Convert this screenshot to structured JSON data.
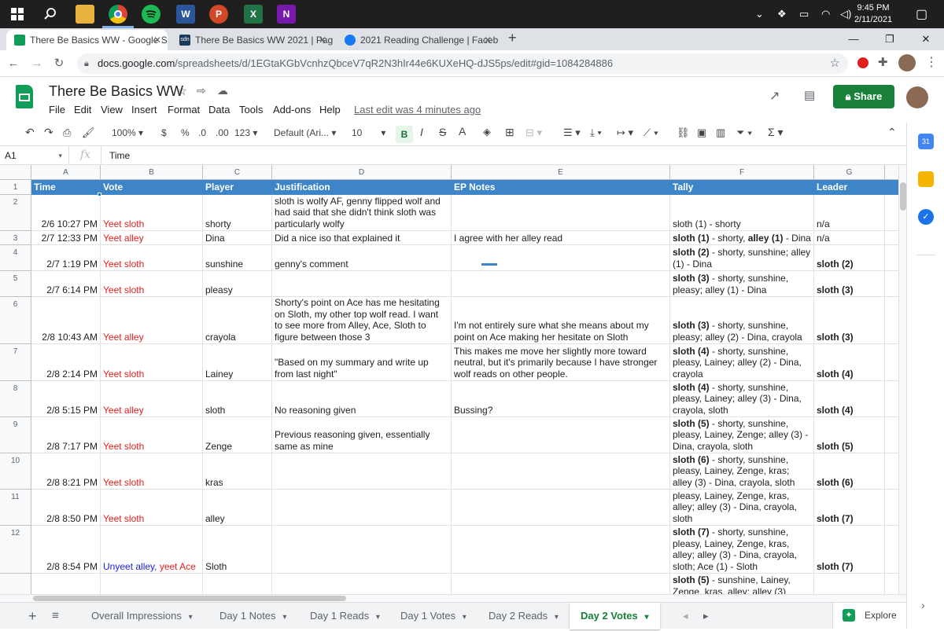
{
  "taskbar": {
    "clock_time": "9:45 PM",
    "clock_date": "2/11/2021",
    "app_icons": [
      "windows-start-icon",
      "search-icon",
      "file-explorer-icon",
      "chrome-icon",
      "spotify-icon",
      "word-icon",
      "powerpoint-icon",
      "excel-icon",
      "onenote-icon"
    ],
    "word_letter": "W",
    "ppt_letter": "P",
    "excel_letter": "X",
    "onenote_letter": "N"
  },
  "browser": {
    "tabs": [
      {
        "title": "There Be Basics WW - Google Sh",
        "active": true
      },
      {
        "title": "There Be Basics WW 2021 | Page",
        "active": false
      },
      {
        "title": "2021 Reading Challenge | Facebo",
        "active": false
      }
    ],
    "tab2_fav_label": "sdn",
    "new_tab": "+",
    "url_host": "docs.google.com",
    "url_path": "/spreadsheets/d/1EGtaKGbVcnhzQbceV7qR2N3hIr44e6KUXeHQ-dJS5ps/edit#gid=1084284886"
  },
  "doc": {
    "title": "There Be Basics WW",
    "menu": [
      "File",
      "Edit",
      "View",
      "Insert",
      "Format",
      "Data",
      "Tools",
      "Add-ons",
      "Help"
    ],
    "last_edit": "Last edit was 4 minutes ago",
    "share_label": "Share"
  },
  "toolbar": {
    "zoom": "100%",
    "currency": "$",
    "percent": "%",
    "dec_decrease": ".0",
    "dec_increase": ".00",
    "more_formats": "123",
    "font": "Default (Ari...",
    "font_size": "10",
    "bold": "B",
    "italic": "I",
    "strike": "S",
    "text_color": "A",
    "functions": "Σ"
  },
  "formula_bar": {
    "cell_ref": "A1",
    "fx": "fx",
    "content": "Time"
  },
  "columns": [
    "A",
    "B",
    "C",
    "D",
    "E",
    "F",
    "G"
  ],
  "rows": [
    "1",
    "2",
    "3",
    "4",
    "5",
    "6",
    "7",
    "8",
    "9",
    "10",
    "11",
    "12"
  ],
  "header_row": [
    "Time",
    "Vote",
    "Player",
    "Justification",
    "EP Notes",
    "Tally",
    "Leader"
  ],
  "data_rows": [
    {
      "time": "2/6 10:27 PM",
      "vote": [
        {
          "t": "Yeet sloth",
          "c": "red"
        }
      ],
      "player": "shorty",
      "just": "sloth is wolfy AF, genny flipped wolf and had said that she didn't think sloth was particularly wolfy",
      "ep": "",
      "tally": [
        {
          "t": "sloth (1) - shorty",
          "b": false
        }
      ],
      "leader": "n/a",
      "leader_bold": false
    },
    {
      "time": "2/7 12:33 PM",
      "vote": [
        {
          "t": "Yeet alley",
          "c": "red"
        }
      ],
      "player": "Dina",
      "just": "Did a nice iso that explained it",
      "ep": "I agree with her alley read",
      "tally": [
        {
          "t": "sloth (1)",
          "b": true
        },
        {
          "t": " - shorty, ",
          "b": false
        },
        {
          "t": "alley (1)",
          "b": true
        },
        {
          "t": " - Dina",
          "b": false
        }
      ],
      "leader": "n/a",
      "leader_bold": false
    },
    {
      "time": "2/7 1:19 PM",
      "vote": [
        {
          "t": "Yeet sloth",
          "c": "red"
        }
      ],
      "player": "sunshine",
      "just": "genny's comment",
      "ep": "",
      "tally": [
        {
          "t": "sloth (2)",
          "b": true
        },
        {
          "t": " - shorty, sunshine; alley (1) - Dina",
          "b": false
        }
      ],
      "leader": "sloth (2)",
      "leader_bold": true
    },
    {
      "time": "2/7 6:14 PM",
      "vote": [
        {
          "t": "Yeet sloth",
          "c": "red"
        }
      ],
      "player": "pleasy",
      "just": "",
      "ep": "",
      "tally": [
        {
          "t": "sloth (3)",
          "b": true
        },
        {
          "t": " - shorty, sunshine, pleasy; alley (1) - Dina",
          "b": false
        }
      ],
      "leader": "sloth (3)",
      "leader_bold": true
    },
    {
      "time": "2/8 10:43 AM",
      "vote": [
        {
          "t": "Yeet alley",
          "c": "red"
        }
      ],
      "player": "crayola",
      "just": "Shorty's point on Ace has me hesitating on Sloth, my other top wolf read. I want to see more from Alley, Ace, Sloth to figure between those 3",
      "ep": "I'm not entirely sure what she means about my point on Ace making her hesitate on Sloth",
      "tally": [
        {
          "t": "sloth (3)",
          "b": true
        },
        {
          "t": " - shorty, sunshine, pleasy; alley (2) - Dina, crayola",
          "b": false
        }
      ],
      "leader": "sloth (3)",
      "leader_bold": true
    },
    {
      "time": "2/8 2:14 PM",
      "vote": [
        {
          "t": "Yeet sloth",
          "c": "red"
        }
      ],
      "player": "Lainey",
      "just": "\"Based on my summary and write up from last night\"",
      "ep": "This makes me move her slightly more toward neutral, but it's primarily because I have stronger wolf reads on other people.",
      "tally": [
        {
          "t": "sloth (4)",
          "b": true
        },
        {
          "t": " - shorty, sunshine, pleasy, Lainey; alley (2) - Dina, crayola",
          "b": false
        }
      ],
      "leader": "sloth (4)",
      "leader_bold": true
    },
    {
      "time": "2/8 5:15 PM",
      "vote": [
        {
          "t": "Yeet alley",
          "c": "red"
        }
      ],
      "player": "sloth",
      "just": "No reasoning given",
      "ep": "Bussing?",
      "tally": [
        {
          "t": "sloth (4)",
          "b": true
        },
        {
          "t": " - shorty, sunshine, pleasy, Lainey; alley (3) - Dina, crayola, sloth",
          "b": false
        }
      ],
      "leader": "sloth (4)",
      "leader_bold": true
    },
    {
      "time": "2/8 7:17 PM",
      "vote": [
        {
          "t": "Yeet sloth",
          "c": "red"
        }
      ],
      "player": "Zenge",
      "just": "Previous reasoning given, essentially same as mine",
      "ep": "",
      "tally": [
        {
          "t": "sloth (5)",
          "b": true
        },
        {
          "t": " - shorty, sunshine, pleasy, Lainey, Zenge; alley (3) - Dina, crayola, sloth",
          "b": false
        }
      ],
      "leader": "sloth (5)",
      "leader_bold": true
    },
    {
      "time": "2/8 8:21 PM",
      "vote": [
        {
          "t": "Yeet sloth",
          "c": "red"
        }
      ],
      "player": "kras",
      "just": "",
      "ep": "",
      "tally": [
        {
          "t": "sloth (6)",
          "b": true
        },
        {
          "t": " - shorty, sunshine, pleasy, Lainey, Zenge, kras; alley (3) - Dina, crayola, sloth",
          "b": false
        }
      ],
      "leader": "sloth (6)",
      "leader_bold": true
    },
    {
      "time": "2/8 8:50 PM",
      "vote": [
        {
          "t": "Yeet sloth",
          "c": "red"
        }
      ],
      "player": "alley",
      "just": "",
      "ep": "",
      "tally": [
        {
          "t": "sloth (7)",
          "b": true
        },
        {
          "t": " - shorty, sunshine, pleasy, Lainey, Zenge, kras, alley; alley (3) - Dina, crayola, sloth",
          "b": false
        }
      ],
      "leader": "sloth (7)",
      "leader_bold": true
    },
    {
      "time": "2/8 8:54 PM",
      "vote": [
        {
          "t": "Unyeet alley",
          "c": "blue"
        },
        {
          "t": ", ",
          "c": "blue"
        },
        {
          "t": "yeet Ace",
          "c": "red"
        }
      ],
      "player": "Sloth",
      "just": "",
      "ep": "",
      "tally": [
        {
          "t": "sloth (7)",
          "b": true
        },
        {
          "t": " - shorty, sunshine, pleasy, Lainey, Zenge, kras, alley; alley (3) - Dina, crayola, sloth; Ace (1) - Sloth",
          "b": false
        }
      ],
      "leader": "sloth (7)",
      "leader_bold": true
    },
    {
      "time": "",
      "vote": [],
      "player": "",
      "just": "",
      "ep": "",
      "tally": [
        {
          "t": "sloth (5)",
          "b": true
        },
        {
          "t": " - sunshine, Lainey, Zenge, kras, alley; alley (3)",
          "b": false
        }
      ],
      "leader": "",
      "leader_bold": false
    }
  ],
  "sheet_tabs": [
    {
      "label": "Overall Impressions",
      "active": false
    },
    {
      "label": "Day 1 Notes",
      "active": false
    },
    {
      "label": "Day 1 Reads",
      "active": false
    },
    {
      "label": "Day 1 Votes",
      "active": false
    },
    {
      "label": "Day 2 Reads",
      "active": false
    },
    {
      "label": "Day 2 Votes",
      "active": true
    }
  ],
  "explore_label": "Explore",
  "colors": {
    "header_blue": "#3d85c6",
    "share_green": "#188038",
    "vote_red": "#e02020",
    "vote_blue": "#2020e0"
  }
}
